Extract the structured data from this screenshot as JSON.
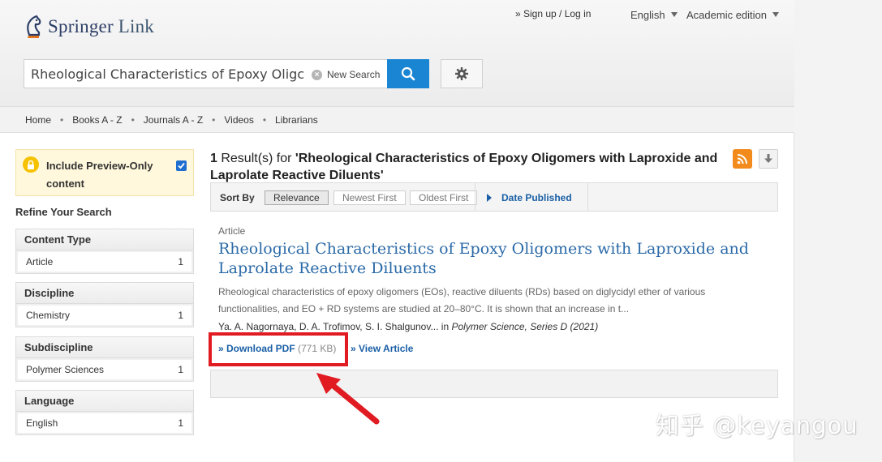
{
  "header": {
    "logo_name": "Springer",
    "logo_link": "Link",
    "login_text": "» Sign up / Log in",
    "language": "English",
    "edition": "Academic edition"
  },
  "search": {
    "value": "Rheological Characteristics of Epoxy Oligc",
    "new_search_label": "New Search"
  },
  "nav": {
    "items": [
      "Home",
      "Books A - Z",
      "Journals A - Z",
      "Videos",
      "Librarians"
    ]
  },
  "sidebar": {
    "preview_text": "Include Preview-Only content",
    "refine_label": "Refine Your Search",
    "facets": [
      {
        "title": "Content Type",
        "item": "Article",
        "count": "1"
      },
      {
        "title": "Discipline",
        "item": "Chemistry",
        "count": "1"
      },
      {
        "title": "Subdiscipline",
        "item": "Polymer Sciences",
        "count": "1"
      },
      {
        "title": "Language",
        "item": "English",
        "count": "1"
      }
    ]
  },
  "results": {
    "count": "1",
    "label": " Result(s) for ",
    "query": "'Rheological Characteristics of Epoxy Oligomers with Laproxide and Laprolate Reactive Diluents'",
    "sort_label": "Sort By",
    "sort_options": [
      "Relevance",
      "Newest First",
      "Oldest First"
    ],
    "date_published": "Date Published"
  },
  "article": {
    "content_type": "Article",
    "title": "Rheological Characteristics of Epoxy Oligomers with Laproxide and Laprolate Reactive Diluents",
    "snippet": "Rheological characteristics of epoxy oligomers (EOs), reactive diluents (RDs) based on diglycidyl ether of various functionalities, and EO + RD systems are studied at 20–80°C. It is shown that an increase in t...",
    "authors": "Ya. A. Nagornaya, D. A. Trofimov, S. I. Shalgunov... in ",
    "publication": "Polymer Science, Series D (2021)",
    "download_label": "» Download PDF",
    "download_size": " (771 KB)",
    "view_label": "» View Article"
  },
  "watermark": "知乎 @keyangou",
  "colors": {
    "brand_blue": "#1a85d3",
    "link_blue": "#1a5fa6",
    "highlight_red": "#e11b22",
    "rss_orange": "#f28a1c"
  }
}
